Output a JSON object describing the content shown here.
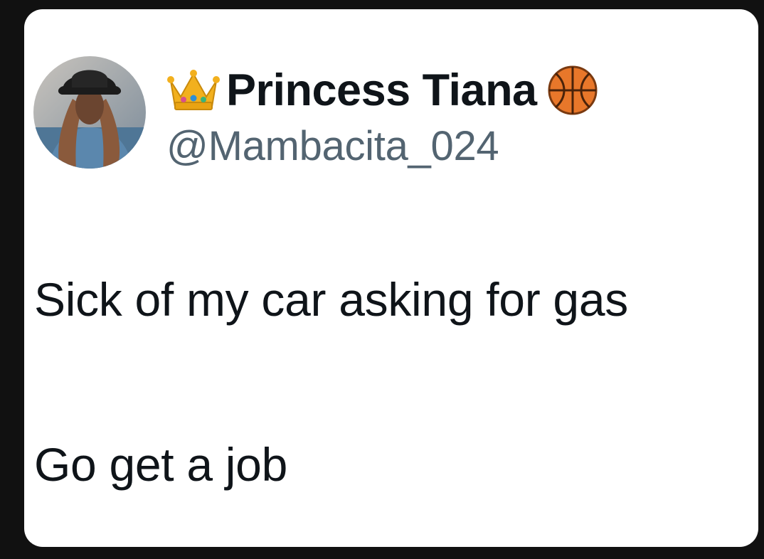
{
  "tweet": {
    "author": {
      "display_name": "Princess Tiana",
      "handle": "@Mambacita_024",
      "avatar_icon": "profile-photo",
      "name_prefix_emoji": "crown-icon",
      "name_suffix_emoji": "basketball-icon"
    },
    "body_lines": [
      "Sick of my car asking for gas",
      "Go get a job"
    ]
  },
  "colors": {
    "background": "#111111",
    "card": "#ffffff",
    "text_primary": "#0f1419",
    "text_secondary": "#536471"
  }
}
